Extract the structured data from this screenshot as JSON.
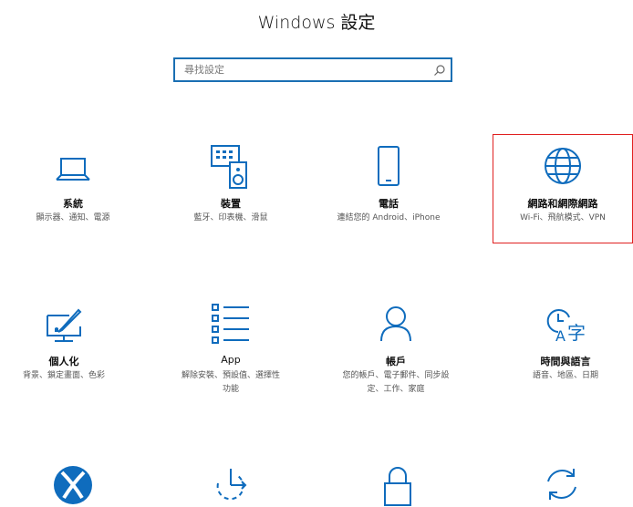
{
  "window": {
    "title": "Windows 設定"
  },
  "search": {
    "placeholder": "尋找設定"
  },
  "tiles": [
    {
      "name": "系統",
      "desc": "顯示器、通知、電源",
      "icon": "laptop-icon"
    },
    {
      "name": "裝置",
      "desc": "藍牙、印表機、滑鼠",
      "icon": "devices-icon"
    },
    {
      "name": "電話",
      "desc": "連結您的 Android、iPhone",
      "icon": "phone-icon"
    },
    {
      "name": "網路和網際網路",
      "desc": "Wi-Fi、飛航模式、VPN",
      "icon": "globe-icon",
      "selected": true
    },
    {
      "name": "個人化",
      "desc": "背景、鎖定畫面、色彩",
      "icon": "personalization-icon"
    },
    {
      "name": "App",
      "desc": "解除安裝、預設值、選擇性功能",
      "icon": "apps-list-icon"
    },
    {
      "name": "帳戶",
      "desc": "您的帳戶、電子郵件、同步設定、工作、家庭",
      "icon": "person-icon"
    },
    {
      "name": "時間與語言",
      "desc": "語音、地區、日期",
      "icon": "time-language-icon"
    },
    {
      "name": "",
      "desc": "",
      "icon": "xbox-icon"
    },
    {
      "name": "",
      "desc": "",
      "icon": "ease-of-access-icon"
    },
    {
      "name": "",
      "desc": "",
      "icon": "lock-icon"
    },
    {
      "name": "",
      "desc": "",
      "icon": "update-sync-icon"
    }
  ],
  "colors": {
    "accent": "#0f6cbd",
    "selection_border": "#e02020",
    "search_border": "#1a6fb3"
  }
}
